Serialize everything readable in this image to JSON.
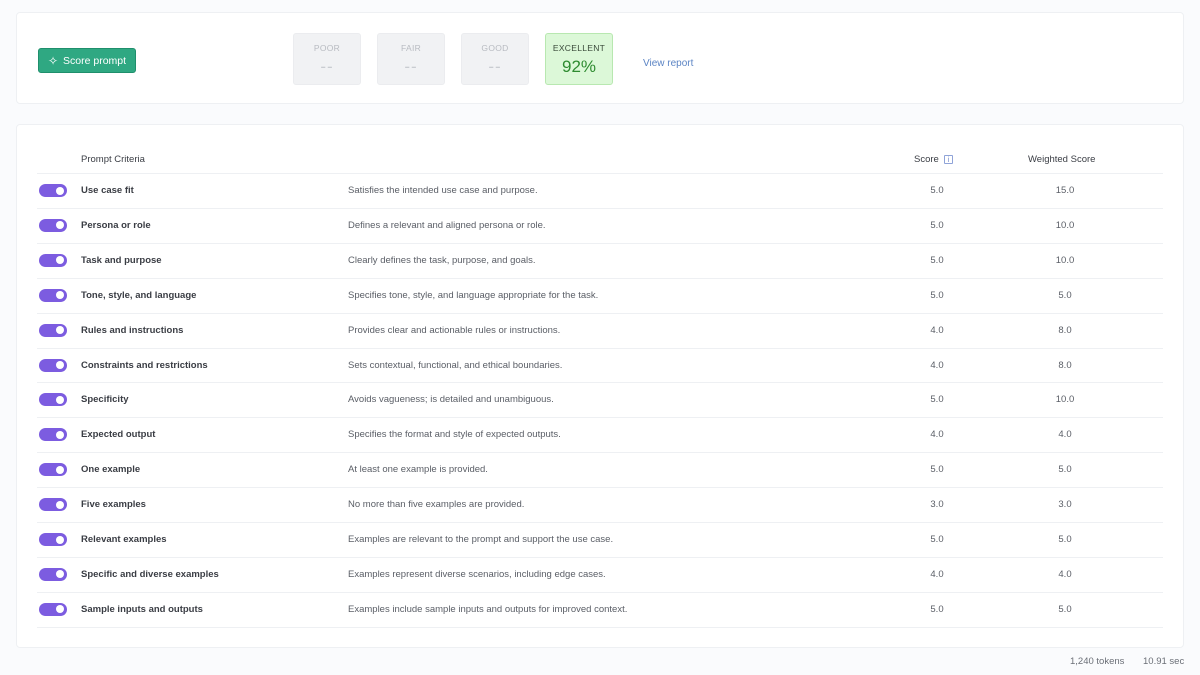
{
  "header": {
    "score_button_label": "Score prompt",
    "view_report_label": "View report",
    "tiers": [
      {
        "label": "POOR",
        "value": "--",
        "active": false
      },
      {
        "label": "FAIR",
        "value": "--",
        "active": false
      },
      {
        "label": "GOOD",
        "value": "--",
        "active": false
      },
      {
        "label": "EXCELLENT",
        "value": "92%",
        "active": true
      }
    ]
  },
  "table": {
    "headers": {
      "criteria": "Prompt Criteria",
      "score": "Score",
      "weighted": "Weighted Score"
    },
    "rows": [
      {
        "enabled": true,
        "name": "Use case fit",
        "description": "Satisfies the intended use case and purpose.",
        "score": "5.0",
        "weighted": "15.0"
      },
      {
        "enabled": true,
        "name": "Persona or role",
        "description": "Defines a relevant and aligned persona or role.",
        "score": "5.0",
        "weighted": "10.0"
      },
      {
        "enabled": true,
        "name": "Task and purpose",
        "description": "Clearly defines the task, purpose, and goals.",
        "score": "5.0",
        "weighted": "10.0"
      },
      {
        "enabled": true,
        "name": "Tone, style, and language",
        "description": "Specifies tone, style, and language appropriate for the task.",
        "score": "5.0",
        "weighted": "5.0"
      },
      {
        "enabled": true,
        "name": "Rules and instructions",
        "description": "Provides clear and actionable rules or instructions.",
        "score": "4.0",
        "weighted": "8.0"
      },
      {
        "enabled": true,
        "name": "Constraints and restrictions",
        "description": "Sets contextual, functional, and ethical boundaries.",
        "score": "4.0",
        "weighted": "8.0"
      },
      {
        "enabled": true,
        "name": "Specificity",
        "description": "Avoids vagueness; is detailed and unambiguous.",
        "score": "5.0",
        "weighted": "10.0"
      },
      {
        "enabled": true,
        "name": "Expected output",
        "description": "Specifies the format and style of expected outputs.",
        "score": "4.0",
        "weighted": "4.0"
      },
      {
        "enabled": true,
        "name": "One example",
        "description": "At least one example is provided.",
        "score": "5.0",
        "weighted": "5.0"
      },
      {
        "enabled": true,
        "name": "Five examples",
        "description": "No more than five examples are provided.",
        "score": "3.0",
        "weighted": "3.0"
      },
      {
        "enabled": true,
        "name": "Relevant examples",
        "description": "Examples are relevant to the prompt and support the use case.",
        "score": "5.0",
        "weighted": "5.0"
      },
      {
        "enabled": true,
        "name": "Specific and diverse examples",
        "description": "Examples represent diverse scenarios, including edge cases.",
        "score": "4.0",
        "weighted": "4.0"
      },
      {
        "enabled": true,
        "name": "Sample inputs and outputs",
        "description": "Examples include sample inputs and outputs for improved context.",
        "score": "5.0",
        "weighted": "5.0"
      }
    ]
  },
  "footer": {
    "tokens": "1,240 tokens",
    "time": "10.91 sec"
  },
  "colors": {
    "accent_green": "#2fa882",
    "toggle_purple": "#7c5ce0",
    "excellent_bg": "#dcf8d8",
    "excellent_text": "#2e8b30",
    "link_blue": "#5b84c4"
  }
}
